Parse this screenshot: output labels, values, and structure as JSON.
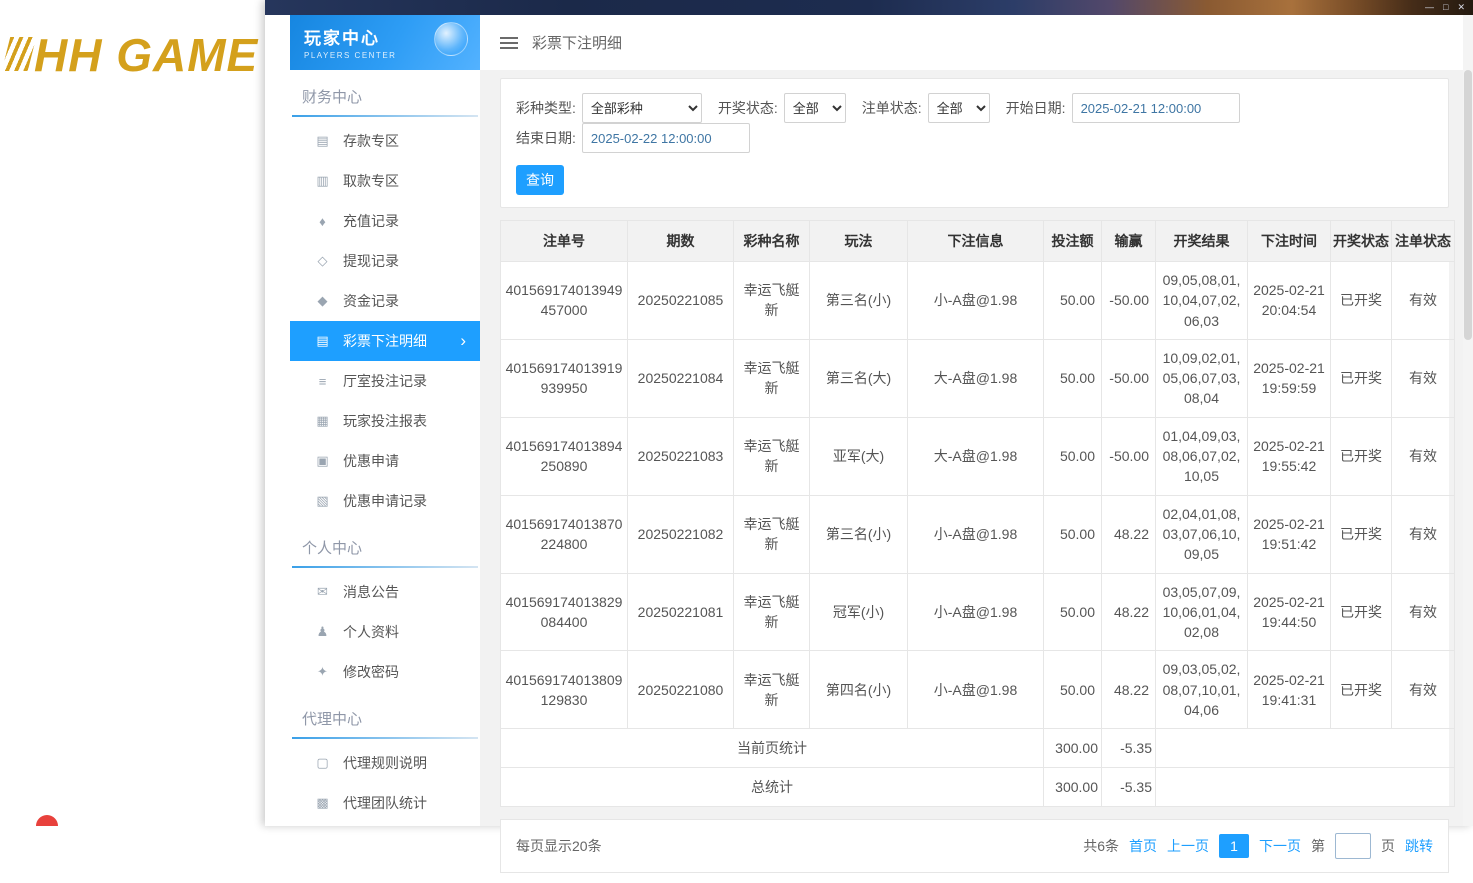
{
  "window": {
    "minimize": "—",
    "maximize": "□",
    "close": "✕"
  },
  "brand": {
    "logo": "HH GAME"
  },
  "sidebar": {
    "title": "玩家中心",
    "subtitle": "PLAYERS CENTER",
    "active_chevron": "›",
    "sections": [
      {
        "title": "财务中心",
        "items": [
          {
            "label": "存款专区",
            "icon": "deposit-icon",
            "glyph": "▤"
          },
          {
            "label": "取款专区",
            "icon": "withdraw-icon",
            "glyph": "▥"
          },
          {
            "label": "充值记录",
            "icon": "recharge-record-icon",
            "glyph": "♦"
          },
          {
            "label": "提现记录",
            "icon": "cashout-record-icon",
            "glyph": "◇"
          },
          {
            "label": "资金记录",
            "icon": "funds-record-icon",
            "glyph": "◆"
          },
          {
            "label": "彩票下注明细",
            "icon": "lottery-bet-detail-icon",
            "glyph": "▤",
            "active": true
          },
          {
            "label": "厅室投注记录",
            "icon": "hall-bet-record-icon",
            "glyph": "≡"
          },
          {
            "label": "玩家投注报表",
            "icon": "player-bet-report-icon",
            "glyph": "▦"
          },
          {
            "label": "优惠申请",
            "icon": "promo-apply-icon",
            "glyph": "▣"
          },
          {
            "label": "优惠申请记录",
            "icon": "promo-apply-record-icon",
            "glyph": "▧"
          }
        ]
      },
      {
        "title": "个人中心",
        "items": [
          {
            "label": "消息公告",
            "icon": "announcement-icon",
            "glyph": "✉"
          },
          {
            "label": "个人资料",
            "icon": "profile-icon",
            "glyph": "♟"
          },
          {
            "label": "修改密码",
            "icon": "password-icon",
            "glyph": "✦"
          }
        ]
      },
      {
        "title": "代理中心",
        "items": [
          {
            "label": "代理规则说明",
            "icon": "agent-rules-icon",
            "glyph": "▢"
          },
          {
            "label": "代理团队统计",
            "icon": "agent-team-stats-icon",
            "glyph": "▩"
          }
        ]
      }
    ]
  },
  "topbar": {
    "title": "彩票下注明细"
  },
  "filters": {
    "lottery_type_label": "彩种类型:",
    "lottery_type_value": "全部彩种",
    "draw_status_label": "开奖状态:",
    "draw_status_value": "全部",
    "order_status_label": "注单状态:",
    "order_status_value": "全部",
    "start_date_label": "开始日期:",
    "start_date_value": "2025-02-21 12:00:00",
    "end_date_label": "结束日期:",
    "end_date_value": "2025-02-22 12:00:00",
    "search_button": "查询"
  },
  "table": {
    "headers": [
      "注单号",
      "期数",
      "彩种名称",
      "玩法",
      "下注信息",
      "投注额",
      "输赢",
      "开奖结果",
      "下注时间",
      "开奖状态",
      "注单状态"
    ],
    "rows": [
      [
        "401569174013949457000",
        "20250221085",
        "幸运飞艇新",
        "第三名(小)",
        "小-A盘@1.98",
        "50.00",
        "-50.00",
        "09,05,08,01,10,04,07,02,06,03",
        "2025-02-21 20:04:54",
        "已开奖",
        "有效"
      ],
      [
        "401569174013919939950",
        "20250221084",
        "幸运飞艇新",
        "第三名(大)",
        "大-A盘@1.98",
        "50.00",
        "-50.00",
        "10,09,02,01,05,06,07,03,08,04",
        "2025-02-21 19:59:59",
        "已开奖",
        "有效"
      ],
      [
        "401569174013894250890",
        "20250221083",
        "幸运飞艇新",
        "亚军(大)",
        "大-A盘@1.98",
        "50.00",
        "-50.00",
        "01,04,09,03,08,06,07,02,10,05",
        "2025-02-21 19:55:42",
        "已开奖",
        "有效"
      ],
      [
        "401569174013870224800",
        "20250221082",
        "幸运飞艇新",
        "第三名(小)",
        "小-A盘@1.98",
        "50.00",
        "48.22",
        "02,04,01,08,03,07,06,10,09,05",
        "2025-02-21 19:51:42",
        "已开奖",
        "有效"
      ],
      [
        "401569174013829084400",
        "20250221081",
        "幸运飞艇新",
        "冠军(小)",
        "小-A盘@1.98",
        "50.00",
        "48.22",
        "03,05,07,09,10,06,01,04,02,08",
        "2025-02-21 19:44:50",
        "已开奖",
        "有效"
      ],
      [
        "401569174013809129830",
        "20250221080",
        "幸运飞艇新",
        "第四名(小)",
        "小-A盘@1.98",
        "50.00",
        "48.22",
        "09,03,05,02,08,07,10,01,04,06",
        "2025-02-21 19:41:31",
        "已开奖",
        "有效"
      ]
    ],
    "summary_rows": [
      {
        "label": "当前页统计",
        "bet_total": "300.00",
        "win_loss_total": "-5.35"
      },
      {
        "label": "总统计",
        "bet_total": "300.00",
        "win_loss_total": "-5.35"
      }
    ]
  },
  "pagination": {
    "page_size_text": "每页显示20条",
    "total_text": "共6条",
    "first_label": "首页",
    "prev_label": "上一页",
    "current_page": "1",
    "next_label": "下一页",
    "jump_prefix": "第",
    "jump_suffix": "页",
    "jump_label": "跳转"
  }
}
